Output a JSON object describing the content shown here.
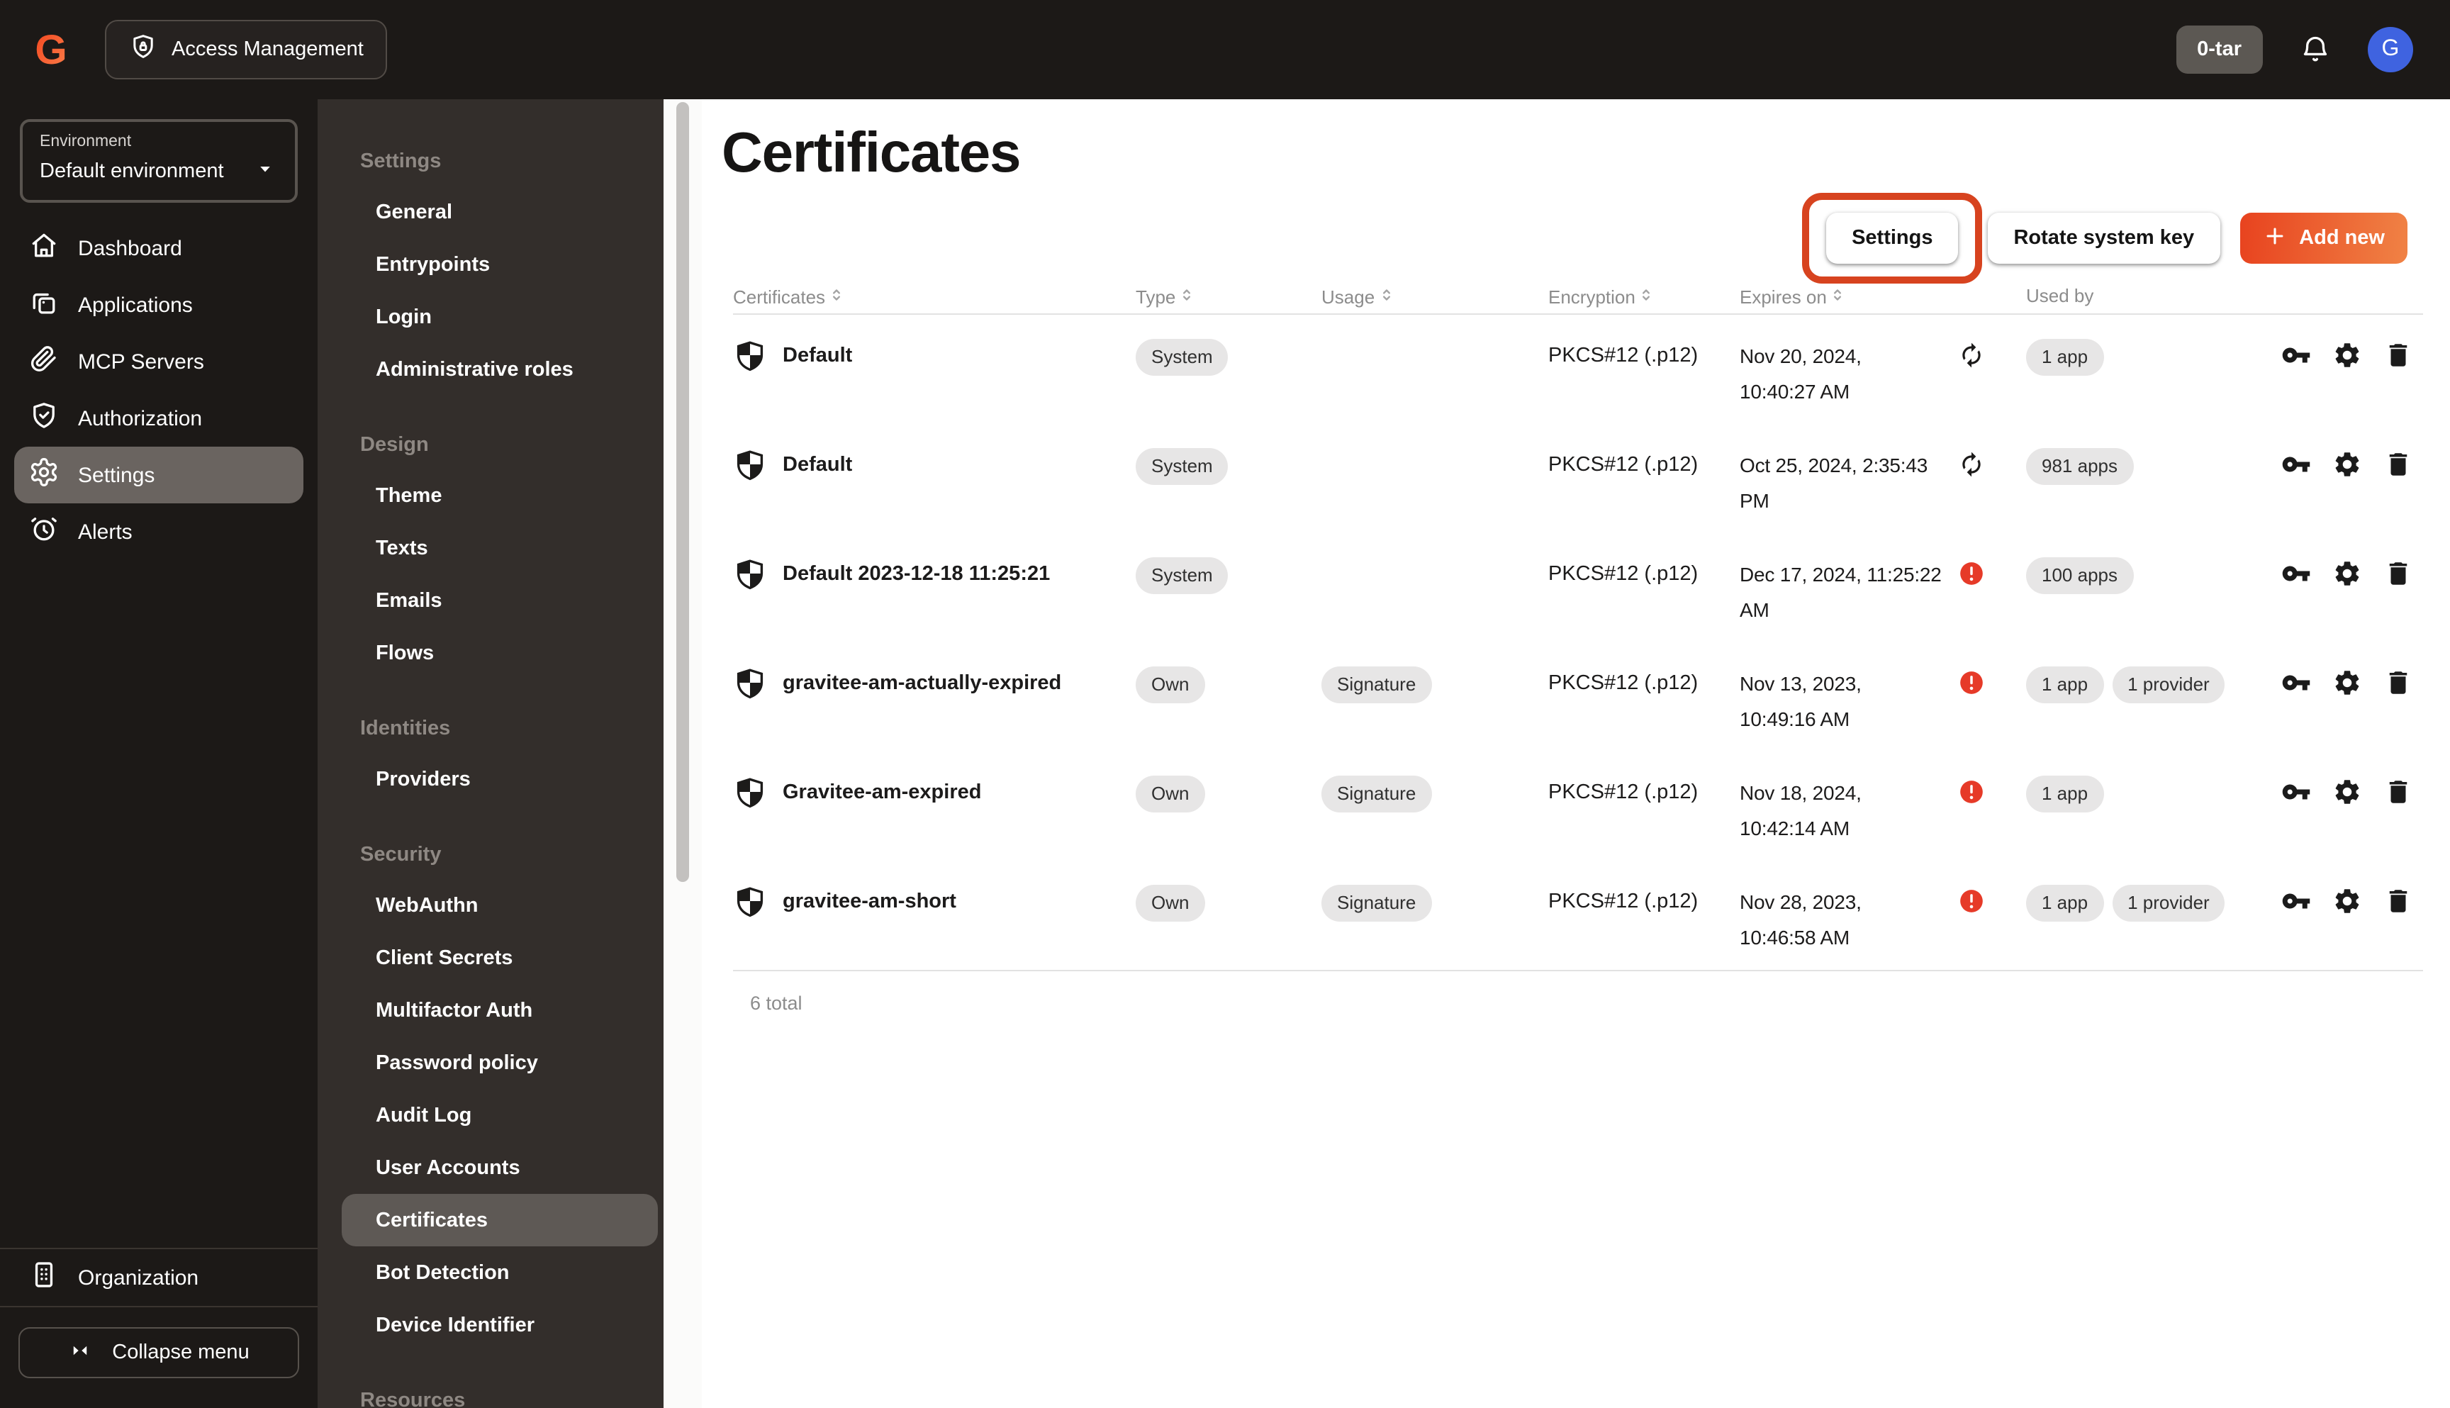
{
  "colors": {
    "accent_from": "#e8431f",
    "accent_to": "#f08245",
    "annotation_red": "#d7431f",
    "warning_red": "#e63a28",
    "avatar_blue": "#3f63e0",
    "chip_bg": "#e7e6e6"
  },
  "topbar": {
    "product": {
      "icon": "shield-lock-icon",
      "label": "Access Management"
    },
    "org_badge": "0-tar",
    "bell_icon": "bell-icon",
    "avatar_initial": "G"
  },
  "environment": {
    "label": "Environment",
    "value": "Default environment",
    "caret_icon": "caret-down-icon"
  },
  "sidebar": {
    "items": [
      {
        "label": "Dashboard",
        "icon": "home-icon",
        "selected": false
      },
      {
        "label": "Applications",
        "icon": "apps-icon",
        "selected": false
      },
      {
        "label": "MCP Servers",
        "icon": "paperclip-icon",
        "selected": false
      },
      {
        "label": "Authorization",
        "icon": "shield-check-icon",
        "selected": false
      },
      {
        "label": "Settings",
        "icon": "gear-icon",
        "selected": true
      },
      {
        "label": "Alerts",
        "icon": "alarm-icon",
        "selected": false
      }
    ],
    "organization": {
      "label": "Organization",
      "icon": "org-icon"
    },
    "collapse": {
      "label": "Collapse menu",
      "icon": "collapse-icon"
    }
  },
  "settings_nav": {
    "selected": "Certificates",
    "sections": [
      {
        "title": "Settings",
        "items": [
          "General",
          "Entrypoints",
          "Login",
          "Administrative roles"
        ]
      },
      {
        "title": "Design",
        "items": [
          "Theme",
          "Texts",
          "Emails",
          "Flows"
        ]
      },
      {
        "title": "Identities",
        "items": [
          "Providers"
        ]
      },
      {
        "title": "Security",
        "items": [
          "WebAuthn",
          "Client Secrets",
          "Multifactor Auth",
          "Password policy",
          "Audit Log",
          "User Accounts",
          "Certificates",
          "Bot Detection",
          "Device Identifier"
        ]
      },
      {
        "title": "Resources",
        "items": []
      }
    ]
  },
  "main": {
    "title": "Certificates",
    "buttons": {
      "settings": "Settings",
      "rotate": "Rotate system key",
      "add_new": "Add new",
      "plus_icon": "plus-icon"
    },
    "table": {
      "headers": [
        {
          "label": "Certificates",
          "sortable": true
        },
        {
          "label": "Type",
          "sortable": true
        },
        {
          "label": "Usage",
          "sortable": true
        },
        {
          "label": "Encryption",
          "sortable": true
        },
        {
          "label": "Expires on",
          "sortable": true
        },
        {
          "label": "Used by",
          "sortable": false
        }
      ],
      "row_actions": [
        "key-icon",
        "gear-solid-icon",
        "trash-icon"
      ],
      "rows": [
        {
          "cert_icon": "cert-shield-icon",
          "name": "Default",
          "type": "System",
          "usage": "",
          "encryption": "PKCS#12 (.p12)",
          "expires_line1": "Nov 20, 2024,",
          "expires_line2": "10:40:27 AM",
          "status_icon": "autorenew-icon",
          "used_by": [
            "1 app"
          ]
        },
        {
          "cert_icon": "cert-shield-icon",
          "name": "Default",
          "type": "System",
          "usage": "",
          "encryption": "PKCS#12 (.p12)",
          "expires_line1": "Oct 25, 2024, 2:35:43",
          "expires_line2": "PM",
          "status_icon": "autorenew-icon",
          "used_by": [
            "981 apps"
          ]
        },
        {
          "cert_icon": "cert-shield-icon",
          "name": "Default 2023-12-18 11:25:21",
          "type": "System",
          "usage": "",
          "encryption": "PKCS#12 (.p12)",
          "expires_line1": "Dec 17, 2024, 11:25:22",
          "expires_line2": "AM",
          "status_icon": "warning-icon",
          "used_by": [
            "100 apps"
          ]
        },
        {
          "cert_icon": "cert-shield-icon",
          "name": "gravitee-am-actually-expired",
          "type": "Own",
          "usage": "Signature",
          "encryption": "PKCS#12 (.p12)",
          "expires_line1": "Nov 13, 2023,",
          "expires_line2": "10:49:16 AM",
          "status_icon": "warning-icon",
          "used_by": [
            "1 app",
            "1 provider"
          ]
        },
        {
          "cert_icon": "cert-shield-icon",
          "name": "Gravitee-am-expired",
          "type": "Own",
          "usage": "Signature",
          "encryption": "PKCS#12 (.p12)",
          "expires_line1": "Nov 18, 2024,",
          "expires_line2": "10:42:14 AM",
          "status_icon": "warning-icon",
          "used_by": [
            "1 app"
          ]
        },
        {
          "cert_icon": "cert-shield-icon",
          "name": "gravitee-am-short",
          "type": "Own",
          "usage": "Signature",
          "encryption": "PKCS#12 (.p12)",
          "expires_line1": "Nov 28, 2023,",
          "expires_line2": "10:46:58 AM",
          "status_icon": "warning-icon",
          "used_by": [
            "1 app",
            "1 provider"
          ]
        }
      ]
    },
    "footer_total": "6 total"
  }
}
